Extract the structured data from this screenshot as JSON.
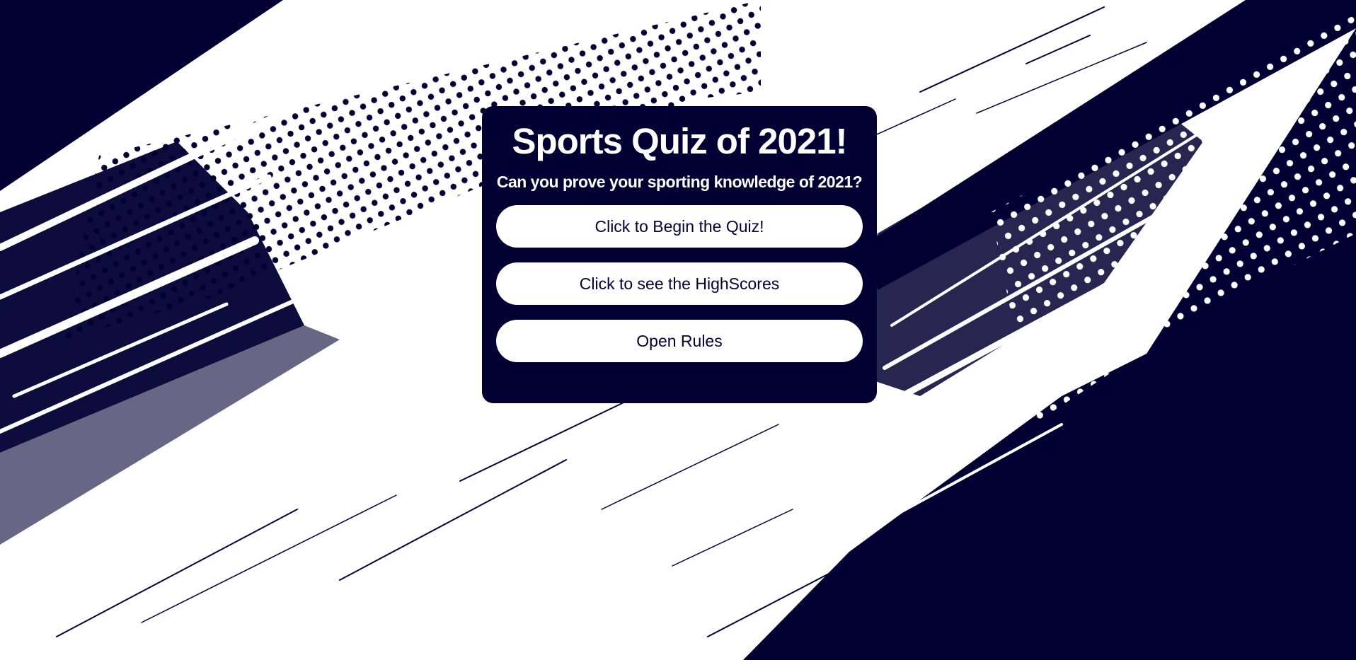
{
  "quiz": {
    "title": "Sports Quiz of 2021!",
    "subtitle": "Can you prove your sporting knowledge of 2021?",
    "buttons": {
      "begin": "Click to Begin the Quiz!",
      "highscores": "Click to see the HighScores",
      "rules": "Open Rules"
    }
  },
  "colors": {
    "navy": "#000033",
    "white": "#ffffff"
  }
}
